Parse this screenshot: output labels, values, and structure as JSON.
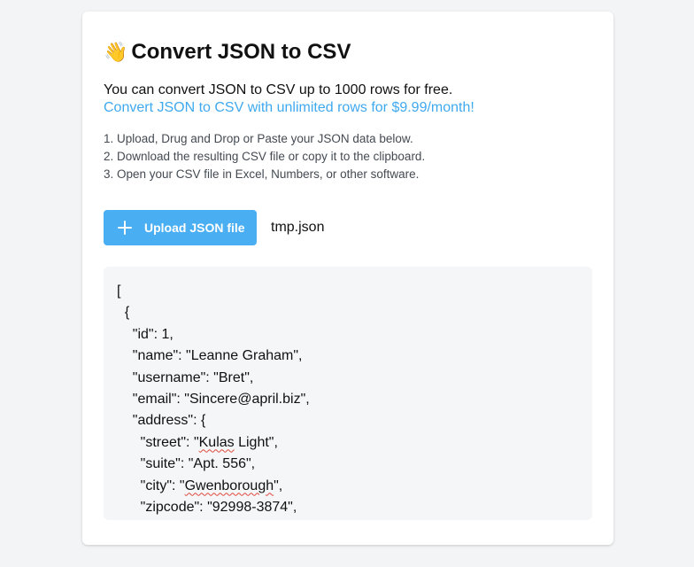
{
  "header": {
    "icon": "waving-hand-icon",
    "emoji": "👋",
    "title": "Convert JSON to CSV"
  },
  "intro": {
    "text": "You can convert JSON to CSV up to 1000 rows for free.",
    "promo_link": "Convert JSON to CSV with unlimited rows for $9.99/month!"
  },
  "steps": [
    "1. Upload, Drug and Drop or Paste your JSON data below.",
    "2. Download the resulting CSV file or copy it to the clipboard.",
    "3. Open your CSV file in Excel, Numbers, or other software."
  ],
  "upload": {
    "button_label": "Upload JSON file",
    "icon": "plus-icon",
    "filename": "tmp.json"
  },
  "editor": {
    "lines": [
      "[",
      "  {",
      "    \"id\": 1,",
      "    \"name\": \"Leanne Graham\",",
      "    \"username\": \"Bret\",",
      "    \"email\": \"Sincere@april.biz\",",
      "    \"address\": {",
      "      \"street\": \"",
      "      \"suite\": \"Apt. 556\",",
      "      \"city\": \"",
      "      \"zipcode\": \"92998-3874\","
    ],
    "street_value": "Kulas",
    "street_rest": " Light\",",
    "city_value": "Gwenborough",
    "city_rest": "\","
  },
  "colors": {
    "accent": "#4aaef2",
    "link": "#3fa9ef",
    "background": "#f3f4f6",
    "editor_bg": "#f5f6f7"
  }
}
